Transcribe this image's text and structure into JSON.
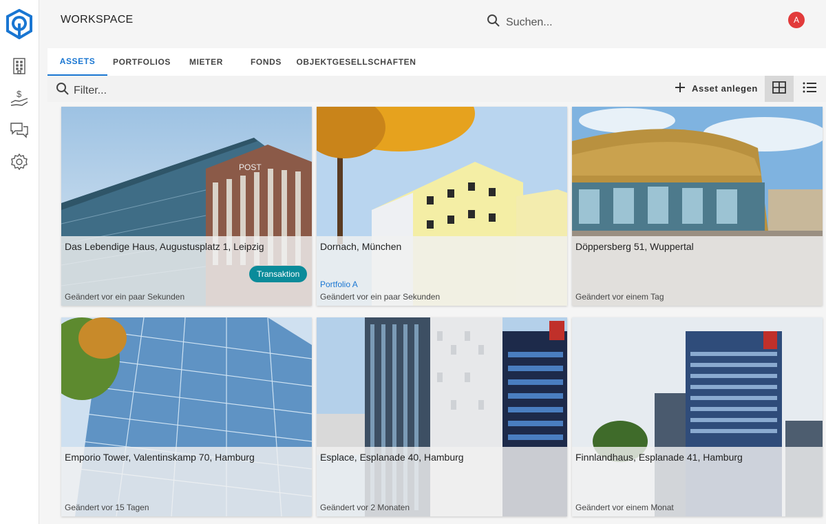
{
  "header": {
    "workspace_label": "WORKSPACE",
    "search_placeholder": "Suchen...",
    "avatar_initial": "A"
  },
  "sidebar": {
    "items": [
      {
        "icon": "building-icon"
      },
      {
        "icon": "money-hand-icon"
      },
      {
        "icon": "chat-icon"
      },
      {
        "icon": "gear-icon"
      }
    ]
  },
  "tabs": [
    {
      "label": "ASSETS",
      "active": true
    },
    {
      "label": "PORTFOLIOS",
      "active": false
    },
    {
      "label": "MIETER",
      "active": false
    },
    {
      "label": "FONDS",
      "active": false
    },
    {
      "label": "OBJEKTGESELLSCHAFTEN",
      "active": false
    }
  ],
  "toolbar": {
    "filter_placeholder": "Filter...",
    "add_asset_label": "Asset anlegen",
    "view_mode": "grid"
  },
  "assets": [
    {
      "title": "Das Lebendige Haus, Augustusplatz 1, Leipzig",
      "portfolio": "",
      "chip": "Transaktion",
      "changed": "Geändert vor ein paar Sekunden"
    },
    {
      "title": "Dornach, München",
      "portfolio": "Portfolio A",
      "chip": "",
      "changed": "Geändert vor ein paar Sekunden"
    },
    {
      "title": "Döppersberg 51, Wuppertal",
      "portfolio": "",
      "chip": "",
      "changed": "Geändert vor einem Tag"
    },
    {
      "title": "Emporio Tower, Valentinskamp 70, Hamburg",
      "portfolio": "",
      "chip": "",
      "changed": "Geändert vor 15 Tagen"
    },
    {
      "title": "Esplace, Esplanade 40, Hamburg",
      "portfolio": "",
      "chip": "",
      "changed": "Geändert vor 2 Monaten"
    },
    {
      "title": "Finnlandhaus, Esplanade 41, Hamburg",
      "portfolio": "",
      "chip": "",
      "changed": "Geändert vor einem Monat"
    }
  ],
  "photo_texts": {
    "post_sign": "POST"
  },
  "colors": {
    "accent": "#1976d2",
    "chip": "#0a8b9a",
    "avatar": "#e23b3b",
    "logo": "#1976d2"
  }
}
